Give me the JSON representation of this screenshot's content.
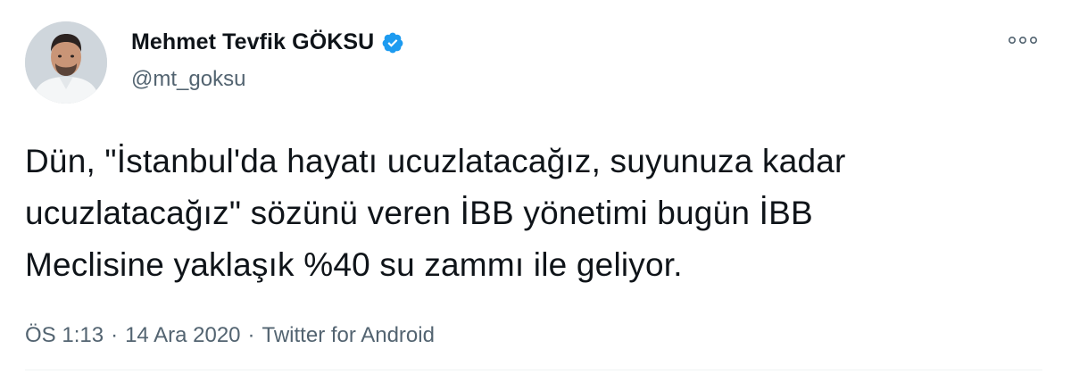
{
  "user": {
    "display_name": "Mehmet Tevfik GÖKSU",
    "handle": "@mt_goksu",
    "verified": true
  },
  "tweet": {
    "lines": [
      "Dün, \"İstanbul'da hayatı ucuzlatacağız, suyunuza kadar",
      "ucuzlatacağız\" sözünü veren İBB yönetimi bugün İBB",
      "Meclisine yaklaşık %40 su zammı ile geliyor."
    ]
  },
  "meta": {
    "time": "ÖS 1:13",
    "separator": "·",
    "date": "14 Ara 2020",
    "source": "Twitter for Android"
  },
  "icons": {
    "verified": "verified-badge-icon",
    "more": "more-options-icon"
  },
  "colors": {
    "verified_blue": "#1d9bf0",
    "secondary_text": "#536471",
    "primary_text": "#0f1419"
  }
}
